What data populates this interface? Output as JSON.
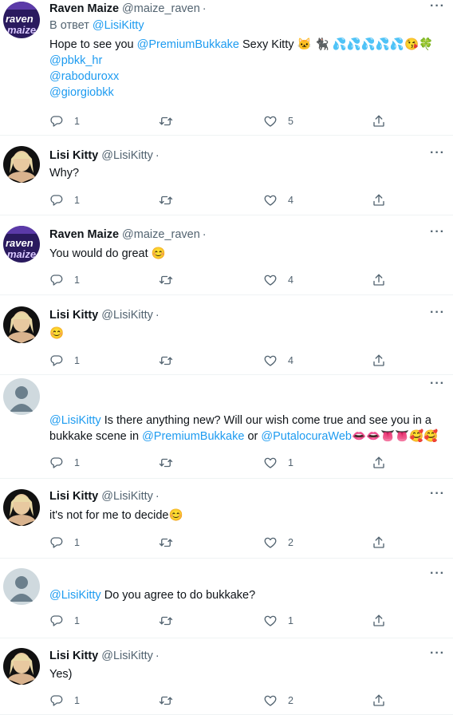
{
  "tweets": [
    {
      "name": "Raven Maize",
      "handle": "@maize_raven",
      "dot": "·",
      "more": "···",
      "avatar": "raven",
      "reply_prefix": "В ответ",
      "reply_to": "@LisiKitty",
      "body_lines": [
        [
          {
            "t": "Hope to see you "
          },
          {
            "t": "@PremiumBukkake",
            "link": true
          },
          {
            "t": " Sexy Kitty 🐱 🐈‍⬛ 💦💦💦💦💦😘🍀"
          }
        ],
        [
          {
            "t": "@pbkk_hr",
            "link": true
          }
        ],
        [
          {
            "t": "@raboduroxx",
            "link": true
          }
        ],
        [
          {
            "t": "@giorgiobkk",
            "link": true
          }
        ]
      ],
      "replies": "1",
      "retweets": "",
      "likes": "5"
    },
    {
      "name": "Lisi Kitty",
      "handle": "@LisiKitty",
      "dot": "·",
      "more": "···",
      "avatar": "lisi",
      "body_lines": [
        [
          {
            "t": "Why?"
          }
        ]
      ],
      "replies": "1",
      "retweets": "",
      "likes": "4"
    },
    {
      "name": "Raven Maize",
      "handle": "@maize_raven",
      "dot": "·",
      "more": "···",
      "avatar": "raven",
      "body_lines": [
        [
          {
            "t": "You would do great 😊"
          }
        ]
      ],
      "replies": "1",
      "retweets": "",
      "likes": "4"
    },
    {
      "name": "Lisi Kitty",
      "handle": "@LisiKitty",
      "dot": "·",
      "more": "···",
      "avatar": "lisi",
      "body_lines": [
        [
          {
            "t": "😊"
          }
        ]
      ],
      "replies": "1",
      "retweets": "",
      "likes": "4"
    },
    {
      "name": "",
      "handle": "",
      "dot": "",
      "more": "···",
      "avatar": "default",
      "body_lines": [
        [
          {
            "t": "@LisiKitty",
            "link": true
          },
          {
            "t": " Is there anything new? Will our wish come true and see you in a"
          }
        ],
        [
          {
            "t": "bukkake scene in "
          },
          {
            "t": "@PremiumBukkake",
            "link": true
          },
          {
            "t": " or "
          },
          {
            "t": "@PutalocuraWeb",
            "link": true
          },
          {
            "t": "👄👄👅👅🥰🥰"
          }
        ]
      ],
      "replies": "1",
      "retweets": "",
      "likes": "1"
    },
    {
      "name": "Lisi Kitty",
      "handle": "@LisiKitty",
      "dot": "·",
      "more": "···",
      "avatar": "lisi",
      "body_lines": [
        [
          {
            "t": "it's not for me to decide😊"
          }
        ]
      ],
      "replies": "1",
      "retweets": "",
      "likes": "2"
    },
    {
      "name": "",
      "handle": "",
      "dot": "",
      "more": "···",
      "avatar": "default",
      "body_lines": [
        [
          {
            "t": "@LisiKitty",
            "link": true
          },
          {
            "t": " Do you agree to do bukkake?"
          }
        ]
      ],
      "replies": "1",
      "retweets": "",
      "likes": "1"
    },
    {
      "name": "Lisi Kitty",
      "handle": "@LisiKitty",
      "dot": "·",
      "more": "···",
      "avatar": "lisi",
      "body_lines": [
        [
          {
            "t": "Yes)"
          }
        ]
      ],
      "replies": "1",
      "retweets": "",
      "likes": "2"
    }
  ]
}
